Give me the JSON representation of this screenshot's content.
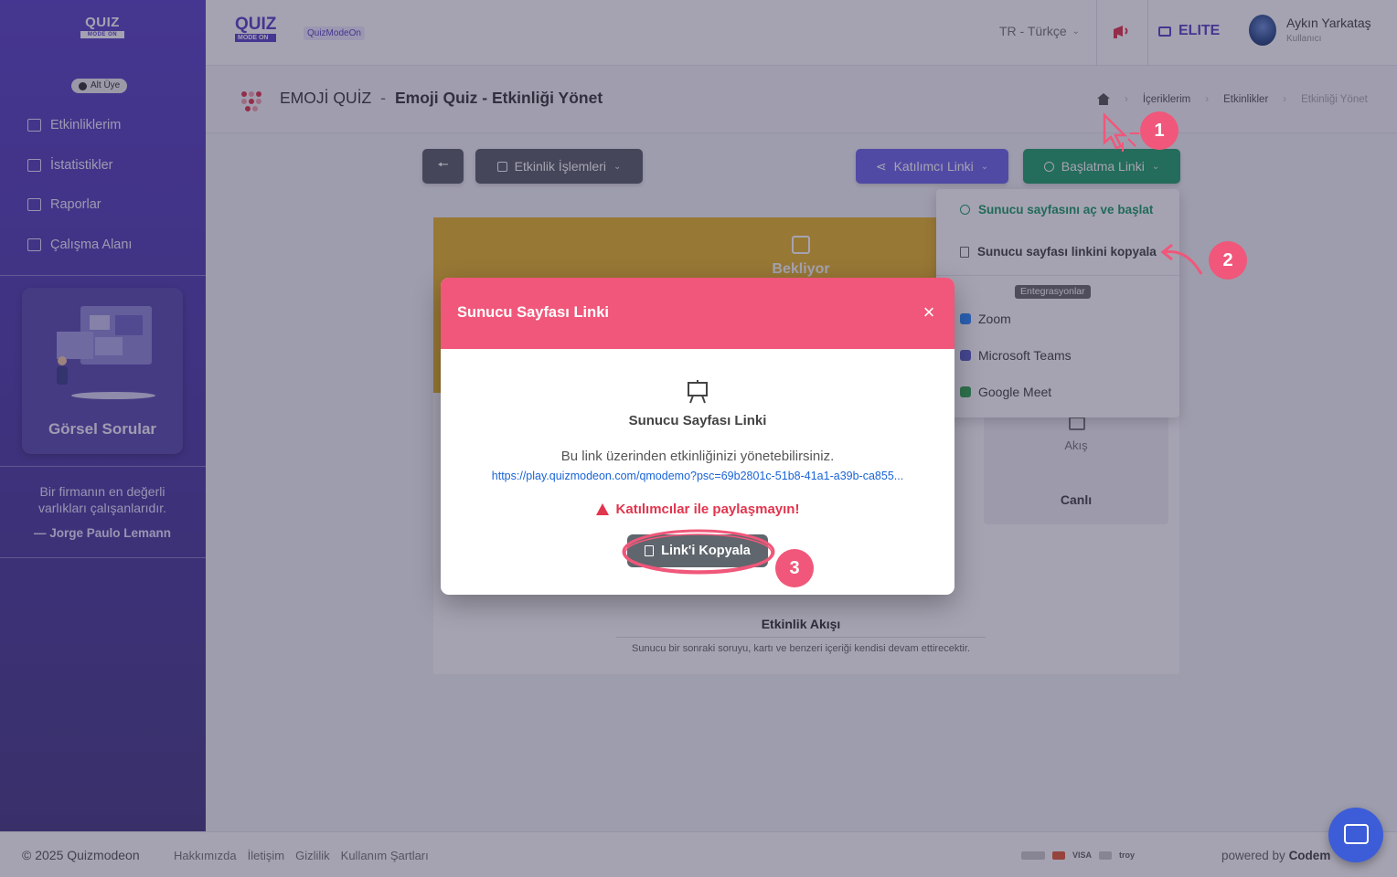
{
  "sidebar": {
    "logo_main": "QUIZ",
    "logo_sub": "MODE ON",
    "member_badge": "Alt Üye",
    "items": [
      {
        "label": "Etkinliklerim"
      },
      {
        "label": "İstatistikler"
      },
      {
        "label": "Raporlar"
      },
      {
        "label": "Çalışma Alanı"
      }
    ],
    "promo_title": "Görsel Sorular",
    "quote_text": "Bir firmanın en değerli varlıkları çalışanlarıdır.",
    "quote_author": "— Jorge Paulo Lemann"
  },
  "topbar": {
    "logo_main": "QUIZ",
    "logo_sub": "MODE ON",
    "brand": "QuizModeOn",
    "language": "TR - Türkçe",
    "plan": "ELITE",
    "user_name": "Aykın Yarkataş",
    "user_role": "Kullanıcı"
  },
  "page_header": {
    "category": "EMOJİ QUİZ",
    "separator": "-",
    "title": "Emoji Quiz - Etkinliği Yönet",
    "breadcrumb": [
      "İçeriklerim",
      "Etkinlikler",
      "Etkinliği Yönet"
    ]
  },
  "toolbar": {
    "activity_ops": "Etkinlik İşlemleri",
    "participant_link": "Katılımcı Linki",
    "start_link": "Başlatma Linki"
  },
  "dropdown": {
    "open_presenter": "Sunucu sayfasını aç ve başlat",
    "copy_presenter_link": "Sunucu sayfası linkini kopyala",
    "integrations_label": "Entegrasyonlar",
    "integrations": [
      {
        "label": "Zoom",
        "color": "#2d8cff"
      },
      {
        "label": "Microsoft Teams",
        "color": "#5b5fc7"
      },
      {
        "label": "Google Meet",
        "color": "#34a853"
      }
    ]
  },
  "main": {
    "status": "Bekliyor",
    "flow_label": "Akış",
    "flow_mode": "Canlı",
    "activity_flow_title": "Etkinlik Akışı",
    "activity_flow_desc": "Sunucu bir sonraki soruyu, kartı ve benzeri içeriği kendisi devam ettirecektir."
  },
  "modal": {
    "title": "Sunucu Sayfası Linki",
    "heading": "Sunucu Sayfası Linki",
    "description": "Bu link üzerinden etkinliğinizi yönetebilirsiniz.",
    "link": "https://play.quizmodeon.com/qmodemo?psc=69b2801c-51b8-41a1-a39b-ca855...",
    "warning": "Katılımcılar ile paylaşmayın!",
    "copy_button": "Link'i Kopyala",
    "close_symbol": "×"
  },
  "footer": {
    "copyright": "© 2025 Quizmodeon",
    "links": [
      "Hakkımızda",
      "İletişim",
      "Gizlilik",
      "Kullanım Şartları"
    ],
    "payment_labels": [
      "VISA",
      "troy"
    ],
    "powered_by_prefix": "powered by",
    "powered_by_name": "Codem"
  },
  "annotations": {
    "steps": [
      "1",
      "2",
      "3"
    ],
    "color": "#f0577a"
  },
  "colors": {
    "accent": "#5b44c8",
    "modal_header": "#f0577a",
    "start_button": "#22a06b",
    "participant_button": "#6e66ea",
    "status_band": "#e9b52a"
  }
}
